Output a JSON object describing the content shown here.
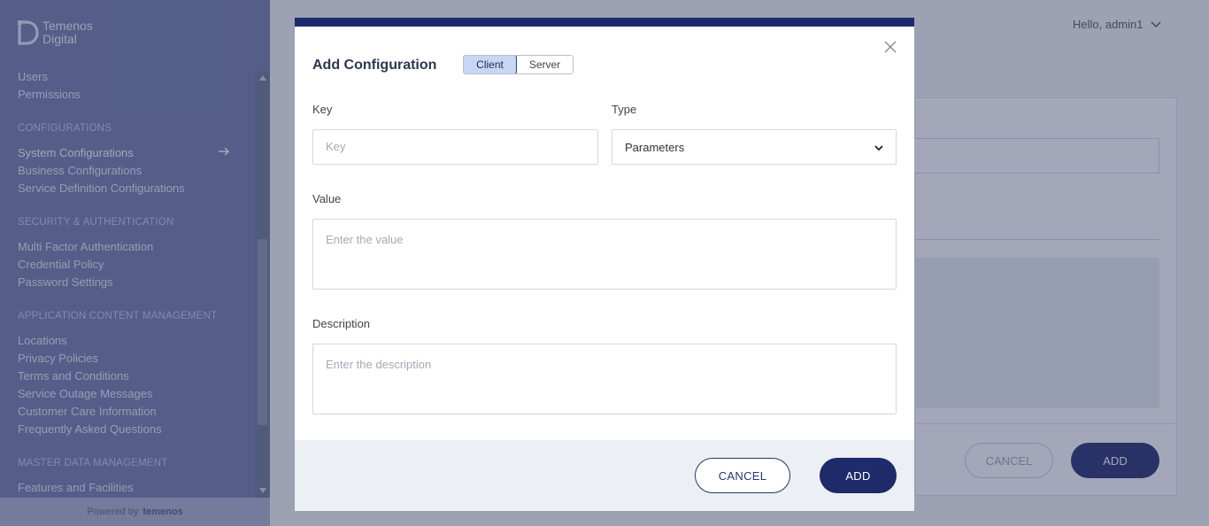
{
  "brand": {
    "line1": "Temenos",
    "line2": "Digital"
  },
  "sidebar": {
    "items": [
      {
        "label": "Users"
      },
      {
        "label": "Permissions"
      }
    ],
    "sections": [
      {
        "heading": "CONFIGURATIONS",
        "items": [
          "System Configurations",
          "Business Configurations",
          "Service Definition Configurations"
        ],
        "active": "System Configurations"
      },
      {
        "heading": "SECURITY & AUTHENTICATION",
        "items": [
          "Multi Factor Authentication",
          "Credential Policy",
          "Password Settings"
        ]
      },
      {
        "heading": "APPLICATION CONTENT MANAGEMENT",
        "items": [
          "Locations",
          "Privacy Policies",
          "Terms and Conditions",
          "Service Outage Messages",
          "Customer Care Information",
          "Frequently Asked Questions"
        ]
      },
      {
        "heading": "MASTER DATA MANAGEMENT",
        "items": [
          "Features and Facilities"
        ]
      }
    ],
    "powered_by": "Powered by",
    "powered_brand": "temenos"
  },
  "header": {
    "greeting": "Hello, admin1"
  },
  "background_page": {
    "cancel_label": "CANCEL",
    "add_label": "ADD"
  },
  "modal": {
    "title": "Add Configuration",
    "toggle": {
      "options": [
        "Client",
        "Server"
      ],
      "selected": "Client"
    },
    "key": {
      "label": "Key",
      "placeholder": "Key",
      "value": ""
    },
    "type": {
      "label": "Type",
      "value": "Parameters"
    },
    "value": {
      "label": "Value",
      "placeholder": "Enter the value",
      "value": ""
    },
    "description": {
      "label": "Description",
      "placeholder": "Enter the description",
      "value": ""
    },
    "cancel_label": "CANCEL",
    "add_label": "ADD"
  },
  "colors": {
    "accent": "#1f2a6b",
    "sidebar": "#6f7ba8",
    "toggle_active": "#c8d6f2"
  }
}
